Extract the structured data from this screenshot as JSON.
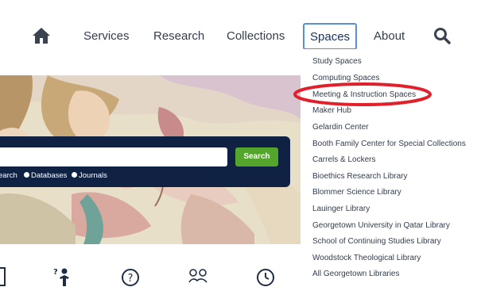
{
  "nav": {
    "items": [
      {
        "label": "Services"
      },
      {
        "label": "Research"
      },
      {
        "label": "Collections"
      },
      {
        "label": "Spaces"
      },
      {
        "label": "About"
      }
    ],
    "active": "Spaces",
    "home_icon": "home-icon",
    "search_icon": "search-icon"
  },
  "search": {
    "button_label": "Search",
    "input_value": "",
    "scopes": [
      {
        "label": "earch"
      },
      {
        "label": "Databases"
      },
      {
        "label": "Journals"
      }
    ]
  },
  "dropdown": {
    "items": [
      {
        "label": "Study Spaces"
      },
      {
        "label": "Computing Spaces"
      },
      {
        "label": "Meeting & Instruction Spaces"
      },
      {
        "label": "Maker Hub"
      },
      {
        "label": "Gelardin Center"
      },
      {
        "label": "Booth Family Center for Special Collections"
      },
      {
        "label": "Carrels & Lockers"
      },
      {
        "label": "Bioethics Research Library"
      },
      {
        "label": "Blommer Science Library"
      },
      {
        "label": "Lauinger Library"
      },
      {
        "label": "Georgetown University in Qatar Library"
      },
      {
        "label": "School of Continuing Studies Library"
      },
      {
        "label": "Woodstock Theological Library"
      },
      {
        "label": "All Georgetown Libraries"
      }
    ],
    "highlighted": "Meeting & Instruction Spaces"
  },
  "bottom_icons": [
    "book-icon",
    "ask-person-icon",
    "help-question-icon",
    "people-chat-icon",
    "clock-icon"
  ],
  "colors": {
    "navy": "#0f2243",
    "accent_green": "#53a62b",
    "annotation_red": "#e0212b",
    "active_border": "#5b8fd1"
  }
}
